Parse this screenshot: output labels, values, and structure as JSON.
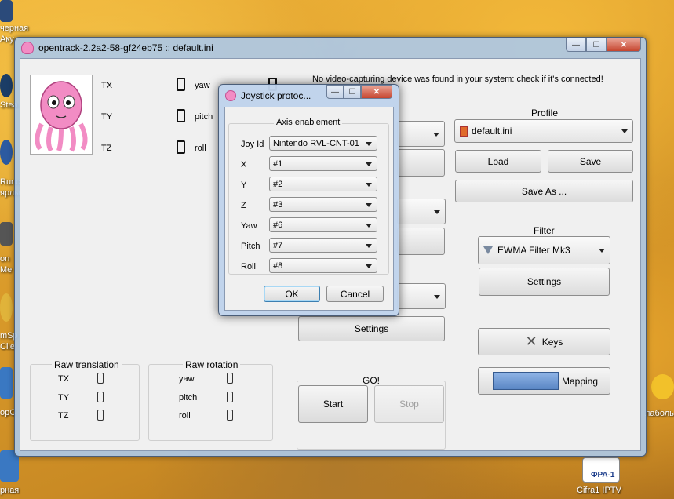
{
  "desktop": {
    "labels": [
      "черная",
      "Аку",
      "Stea",
      "Runc",
      "ярлы",
      "on",
      "Me",
      "mSp",
      "Clie",
      "opC",
      "рная",
      "Cifra1 IPTV",
      "ФРА-1",
      "лаболь"
    ]
  },
  "window": {
    "title": "opentrack-2.2a2-58-gf24eb75 :: default.ini",
    "caption": {
      "minimize": "—",
      "maximize": "☐",
      "close": "✕"
    },
    "status_message": "No video-capturing device was found in your system: check if it's connected!",
    "pose": {
      "tx": "TX",
      "ty": "TY",
      "tz": "TZ",
      "yaw": "yaw",
      "pitch": "pitch",
      "roll": "roll"
    },
    "raw_translation": {
      "title": "Raw translation",
      "tx": "TX",
      "ty": "TY",
      "tz": "TZ"
    },
    "raw_rotation": {
      "title": "Raw rotation",
      "yaw": "yaw",
      "pitch": "pitch",
      "roll": "roll"
    },
    "profile": {
      "title": "Profile",
      "selected": "default.ini",
      "load": "Load",
      "save": "Save",
      "save_as": "Save As ..."
    },
    "filter": {
      "title": "Filter",
      "selected": "EWMA Filter Mk3",
      "settings": "Settings"
    },
    "protocol": {
      "settings": "Settings"
    },
    "keys": "Keys",
    "mapping": "Mapping",
    "go": {
      "title": "GO!",
      "start": "Start",
      "stop": "Stop"
    }
  },
  "dialog": {
    "title": "Joystick protoc...",
    "caption": {
      "minimize": "—",
      "maximize": "☐",
      "close": "✕"
    },
    "group_title": "Axis enablement",
    "rows": [
      {
        "label": "Joy Id",
        "value": "Nintendo RVL-CNT-01"
      },
      {
        "label": "X",
        "value": "#1"
      },
      {
        "label": "Y",
        "value": "#2"
      },
      {
        "label": "Z",
        "value": "#3"
      },
      {
        "label": "Yaw",
        "value": "#6"
      },
      {
        "label": "Pitch",
        "value": "#7"
      },
      {
        "label": "Roll",
        "value": "#8"
      }
    ],
    "ok": "OK",
    "cancel": "Cancel"
  },
  "colors": {
    "window_frame": "#adc8e6",
    "mascot_pink": "#f28cc4",
    "accent_blue": "#3a6db3"
  }
}
